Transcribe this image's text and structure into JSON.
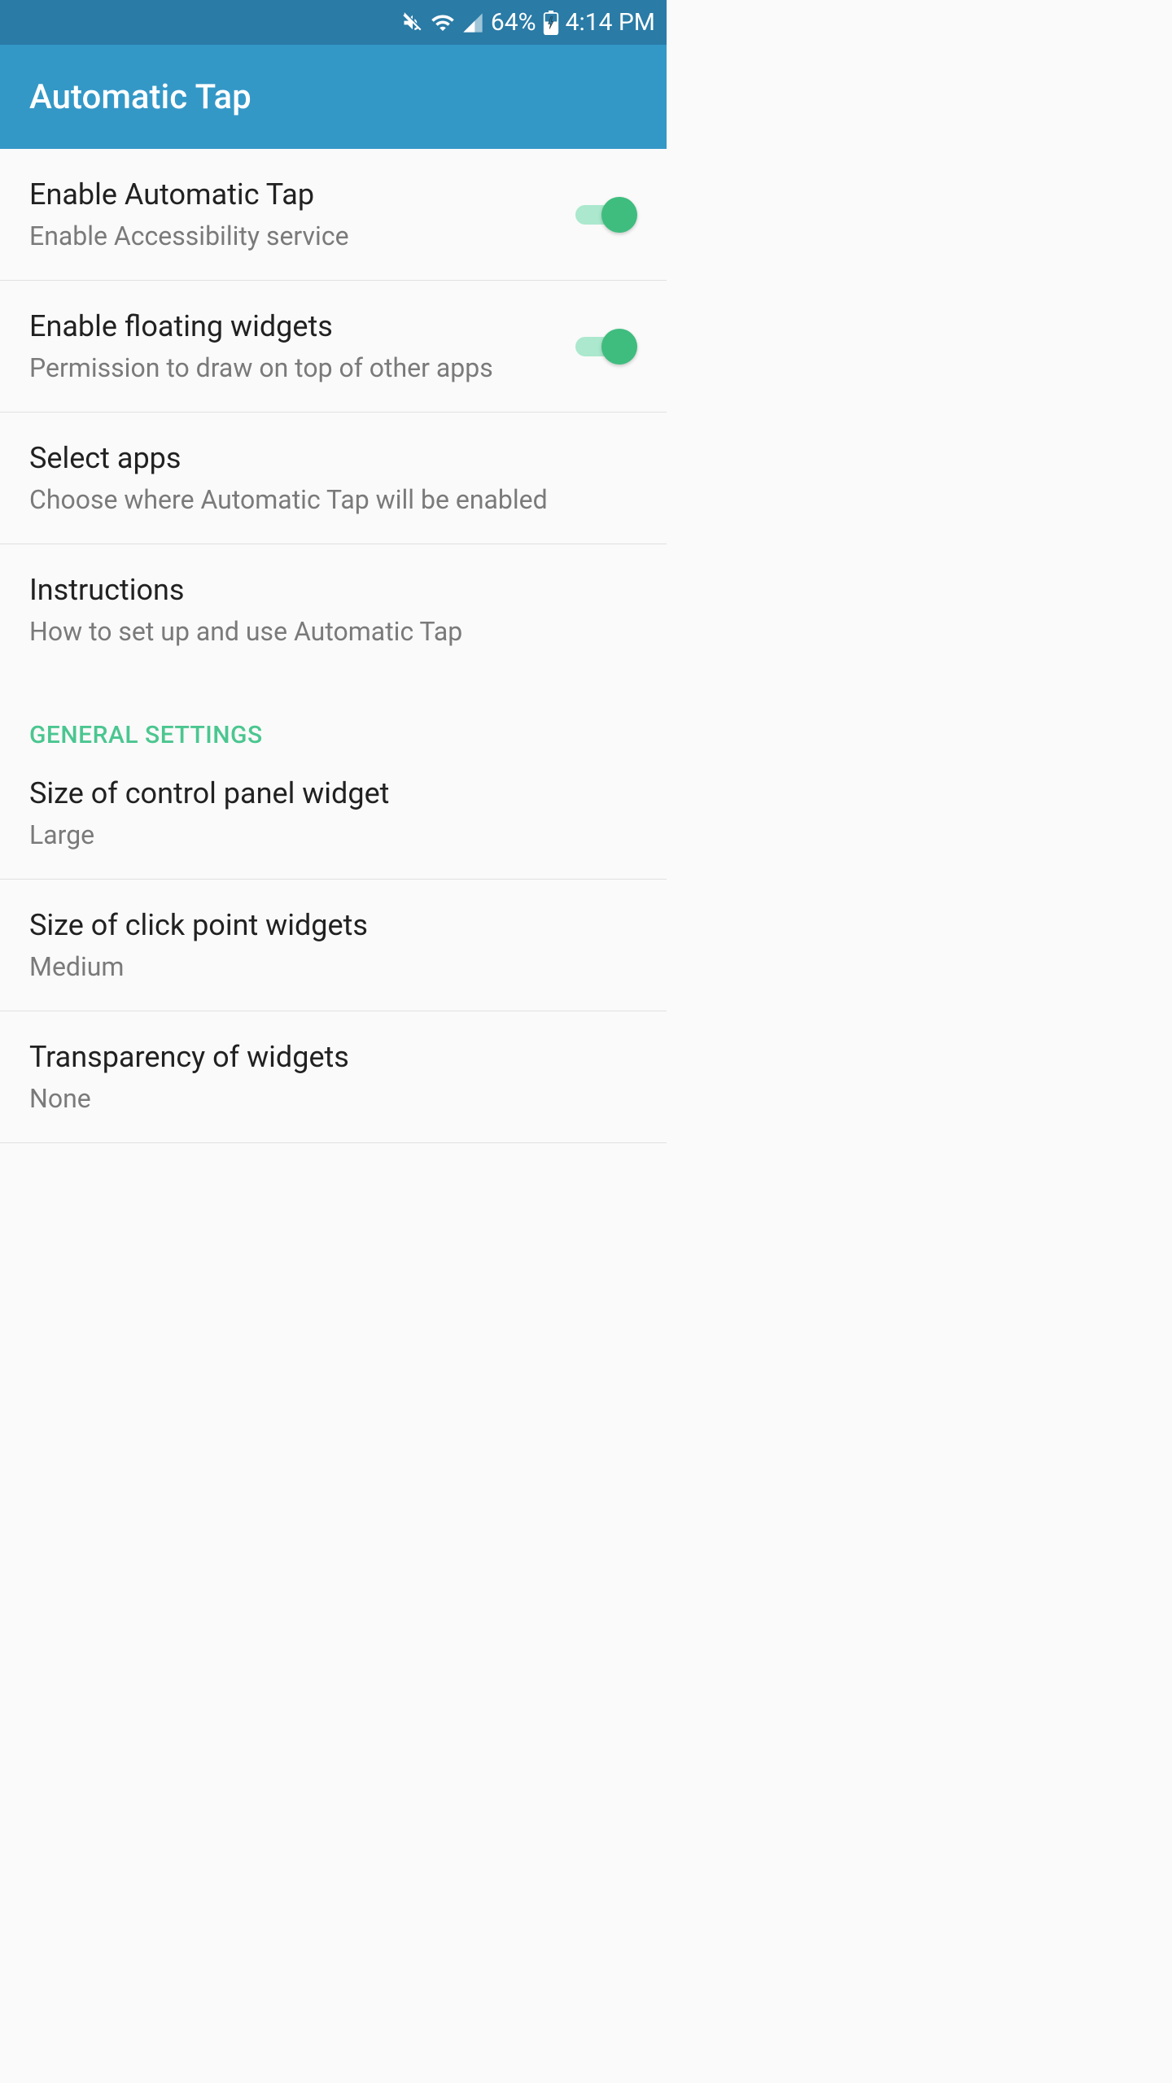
{
  "status": {
    "battery_pct": "64%",
    "time": "4:14 PM"
  },
  "app": {
    "title": "Automatic Tap"
  },
  "rows": {
    "enable_tap": {
      "title": "Enable Automatic Tap",
      "subtitle": "Enable Accessibility service"
    },
    "enable_widgets": {
      "title": "Enable floating widgets",
      "subtitle": "Permission to draw on top of other apps"
    },
    "select_apps": {
      "title": "Select apps",
      "subtitle": "Choose where Automatic Tap will be enabled"
    },
    "instructions": {
      "title": "Instructions",
      "subtitle": "How to set up and use Automatic Tap"
    }
  },
  "section": {
    "general": "GENERAL SETTINGS"
  },
  "settings": {
    "control_panel_size": {
      "title": "Size of control panel widget",
      "value": "Large"
    },
    "click_point_size": {
      "title": "Size of click point widgets",
      "value": "Medium"
    },
    "transparency": {
      "title": "Transparency of widgets",
      "value": "None"
    }
  }
}
